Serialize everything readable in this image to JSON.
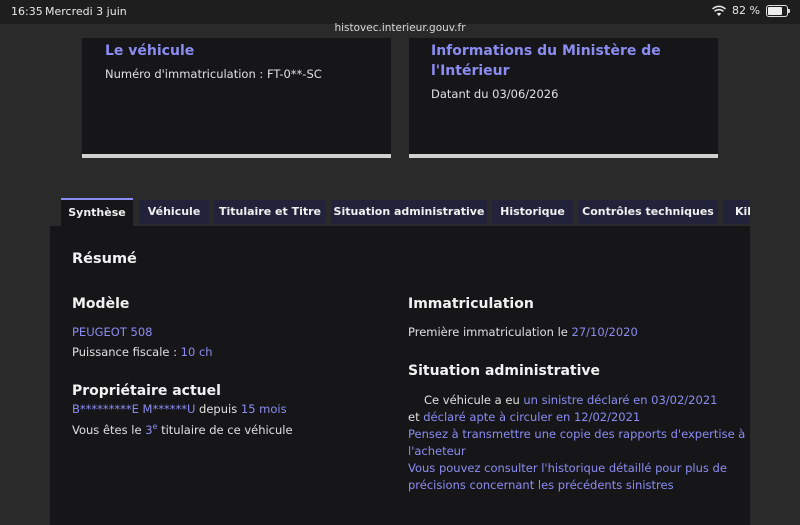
{
  "status_bar": {
    "time": "16:35",
    "date": "Mercredi 3 juin",
    "battery": "82 %"
  },
  "browser": {
    "url": "histovec.interieur.gouv.fr"
  },
  "cards": {
    "vehicle": {
      "title": "Le véhicule",
      "plate_label": "Numéro d'immatriculation : FT-0**-SC"
    },
    "ministry": {
      "title_line1": "Informations du Ministère de",
      "title_line2": "l'Intérieur",
      "date_text": "Datant du 03/06/2026"
    }
  },
  "tabs": [
    "Synthèse",
    "Véhicule",
    "Titulaire et Titre",
    "Situation administrative",
    "Historique",
    "Contrôles techniques",
    "Kil"
  ],
  "summary": {
    "title": "Résumé",
    "model_heading": "Modèle",
    "model_value": "PEUGEOT 508",
    "power_label": "Puissance fiscale : ",
    "power_value": "10 ch",
    "owner_heading": "Propriétaire actuel",
    "owner_name": "B*********E M******U",
    "owner_since_label": " depuis ",
    "owner_since_value": "15 mois",
    "owner_rank_prefix": "Vous êtes le ",
    "owner_rank_num": "3",
    "owner_rank_sup": "e",
    "owner_rank_suffix": " titulaire de ce véhicule",
    "registration_heading": "Immatriculation",
    "first_reg_label": "Première immatriculation le ",
    "first_reg_date": "27/10/2020",
    "admin_heading": "Situation administrative",
    "claim_prefix": "Ce véhicule a eu ",
    "claim_link": "un sinistre déclaré en 03/02/2021",
    "fit_prefix": "et ",
    "fit_link": "déclaré apte à circuler en 12/02/2021",
    "advice1_line1": "Pensez à transmettre une copie des rapports d'expertise à",
    "advice1_line2": "l'acheteur",
    "advice2_line1": "Vous pouvez consulter l'historique détaillé pour plus de",
    "advice2_line2": "précisions concernant les précédents sinistres"
  },
  "colors": {
    "accent": "#8b8cf2",
    "panel": "#161618",
    "tab_bg": "#22223a",
    "page_bg": "#2a2a2a"
  }
}
